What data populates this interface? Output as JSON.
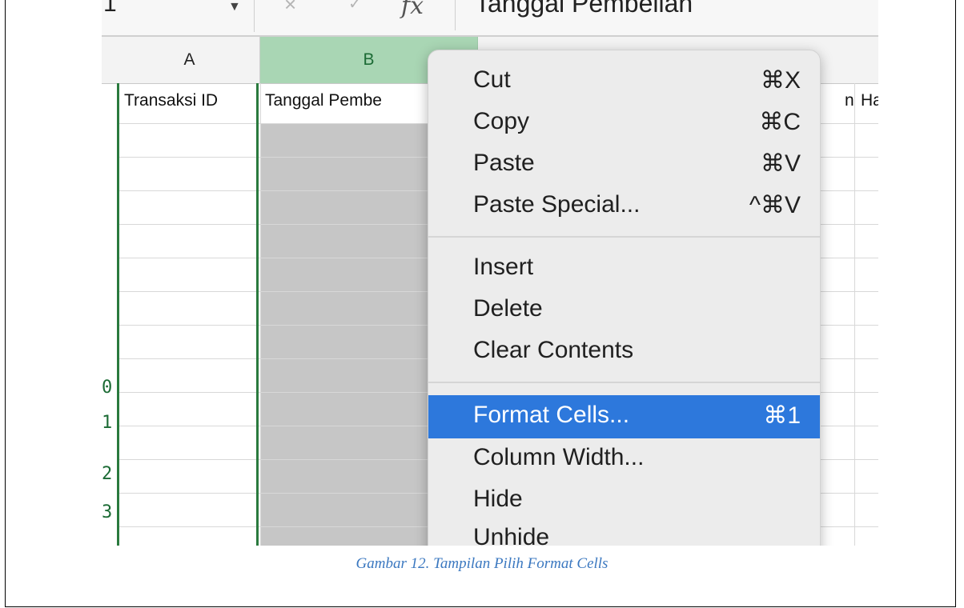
{
  "formula_bar": {
    "name_box": "1",
    "cancel_symbol": "×",
    "confirm_symbol": "✓",
    "fx_label": "fx",
    "value": "Tanggal Pembelian"
  },
  "columns": [
    "A",
    "B"
  ],
  "row_numbers": [
    "0",
    "1",
    "2",
    "3"
  ],
  "header_cells": {
    "a": "Transaksi ID",
    "b": "Tanggal Pembe",
    "partial_1": "n",
    "partial_2": "Har"
  },
  "context_menu": {
    "cut": {
      "label": "Cut",
      "shortcut": "⌘X"
    },
    "copy": {
      "label": "Copy",
      "shortcut": "⌘C"
    },
    "paste": {
      "label": "Paste",
      "shortcut": "⌘V"
    },
    "paste_special": {
      "label": "Paste Special...",
      "shortcut": "^⌘V"
    },
    "insert": {
      "label": "Insert"
    },
    "delete": {
      "label": "Delete"
    },
    "clear_contents": {
      "label": "Clear Contents"
    },
    "format_cells": {
      "label": "Format Cells...",
      "shortcut": "⌘1"
    },
    "column_width": {
      "label": "Column Width..."
    },
    "hide": {
      "label": "Hide"
    },
    "unhide": {
      "label": "Unhide"
    }
  },
  "caption": "Gambar 12. Tampilan Pilih Format Cells",
  "colors": {
    "selection_green": "#2a7a3e",
    "menu_highlight": "#2d78dc",
    "caption_blue": "#3b78c0"
  }
}
